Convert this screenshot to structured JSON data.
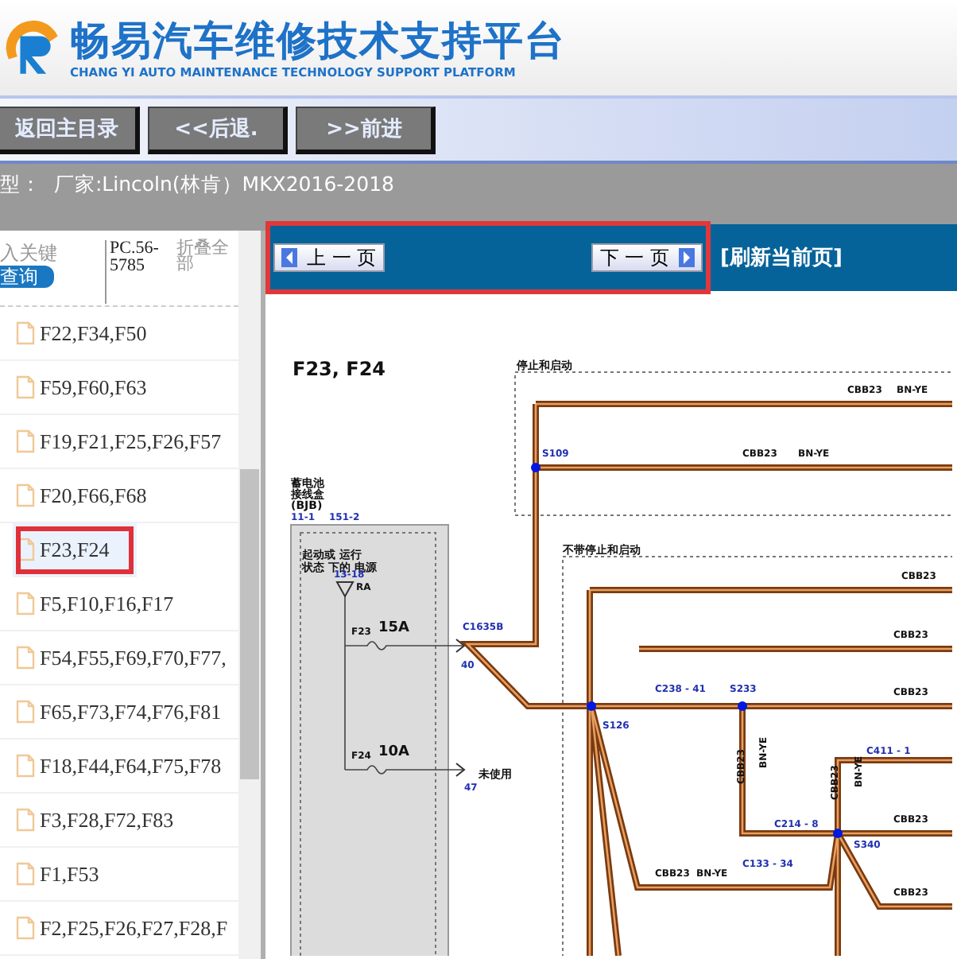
{
  "header": {
    "title": "畅易汽车维修技术支持平台",
    "subtitle": "CHANG YI AUTO MAINTENANCE TECHNOLOGY SUPPORT PLATFORM"
  },
  "nav_buttons": [
    "返回主目录",
    "<<后退.",
    ">>前进"
  ],
  "vehicle_line": "型：  厂家:Lincoln(林肯）MKX2016-2018",
  "sidebar": {
    "search": {
      "placeholder": "入关键"
    },
    "search_button": "查询",
    "code": "PC.56-5785",
    "collapse": "折叠全部",
    "items": [
      {
        "label": "F22,F34,F50",
        "selected": false
      },
      {
        "label": "F59,F60,F63",
        "selected": false
      },
      {
        "label": "F19,F21,F25,F26,F57",
        "selected": false
      },
      {
        "label": "F20,F66,F68",
        "selected": false
      },
      {
        "label": "F23,F24",
        "selected": true
      },
      {
        "label": "F5,F10,F16,F17",
        "selected": false
      },
      {
        "label": "F54,F55,F69,F70,F77,",
        "selected": false
      },
      {
        "label": "F65,F73,F74,F76,F81",
        "selected": false
      },
      {
        "label": "F18,F44,F64,F75,F78",
        "selected": false
      },
      {
        "label": "F3,F28,F72,F83",
        "selected": false
      },
      {
        "label": "F1,F53",
        "selected": false
      },
      {
        "label": "F2,F25,F26,F27,F28,F",
        "selected": false
      }
    ]
  },
  "pager": {
    "prev": "上 一 页",
    "next": "下 一 页",
    "refresh": "[刷新当前页]"
  },
  "diagram": {
    "title": "F23, F24",
    "labels": [
      "停止和启动",
      "CBB23",
      "BN-YE",
      "S109",
      "CBB23",
      "BN-YE",
      "蓄电池",
      "接线盒",
      "(BJB)",
      "11-1",
      "151-2",
      "起动或 运行",
      "状态 下的 电源",
      "13-18",
      "RA",
      "F23",
      "15A",
      "C1635B",
      "40",
      "F24",
      "10A",
      "未使用",
      "47",
      "不带停止和启动",
      "CBB23",
      "CBB23",
      "C238 - 41",
      "S233",
      "CBB23",
      "S126",
      "CBB23",
      "BN-YE",
      "C411 - 1",
      "C214 - 8",
      "CBB23",
      "BN-YE",
      "S340",
      "CBB23",
      "CBB23",
      "BN-YE",
      "C133 - 34",
      "CBB23"
    ]
  }
}
